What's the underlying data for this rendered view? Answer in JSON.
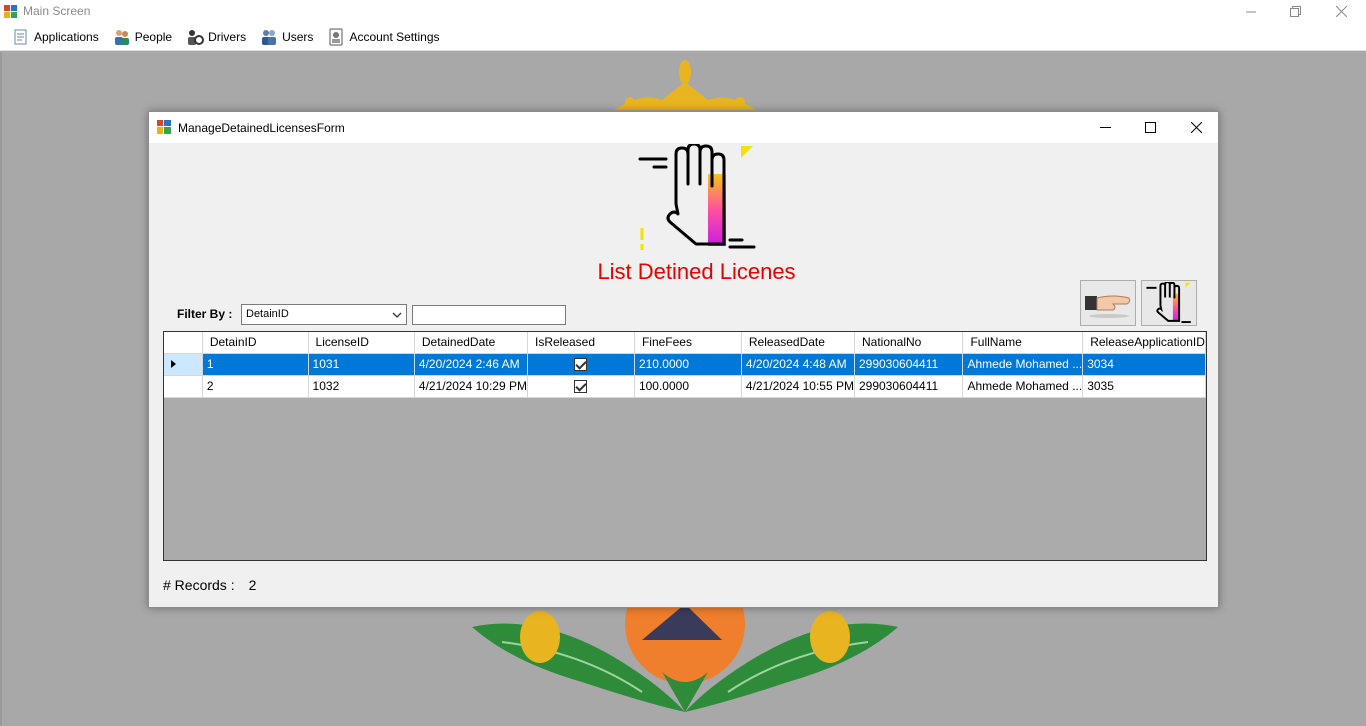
{
  "main_window": {
    "title": "Main Screen"
  },
  "menu": {
    "items": [
      {
        "label": "Applications",
        "icon": "document-icon"
      },
      {
        "label": "People",
        "icon": "people-icon"
      },
      {
        "label": "Drivers",
        "icon": "drivers-icon"
      },
      {
        "label": "Users",
        "icon": "users-icon"
      },
      {
        "label": "Account Settings",
        "icon": "account-settings-icon"
      }
    ]
  },
  "form": {
    "title": "ManageDetainedLicensesForm",
    "heading": "List Detined Licenes",
    "filter": {
      "label": "Filter By :",
      "selected": "DetainID",
      "text": ""
    },
    "records_label": "# Records :",
    "records_count": "2"
  },
  "grid": {
    "columns": [
      "DetainID",
      "LicenseID",
      "DetainedDate",
      "IsReleased",
      "FineFees",
      "ReleasedDate",
      "NationalNo",
      "FullName",
      "ReleaseApplicationID"
    ],
    "rows": [
      {
        "detain_id": "1",
        "license_id": "1031",
        "detained_date": "4/20/2024 2:46 AM",
        "is_released": true,
        "fine_fees": "210.0000",
        "released_date": "4/20/2024 4:48 AM",
        "national_no": "299030604411",
        "full_name": "Ahmede Mohamed ...",
        "release_app_id": "3034"
      },
      {
        "detain_id": "2",
        "license_id": "1032",
        "detained_date": "4/21/2024 10:29 PM",
        "is_released": true,
        "fine_fees": "100.0000",
        "released_date": "4/21/2024 10:55 PM",
        "national_no": "299030604411",
        "full_name": "Ahmede Mohamed ...",
        "release_app_id": "3035"
      }
    ]
  },
  "colors": {
    "heading": "#e60000",
    "selection": "#0078d7",
    "desktop": "#a8a8a8"
  }
}
